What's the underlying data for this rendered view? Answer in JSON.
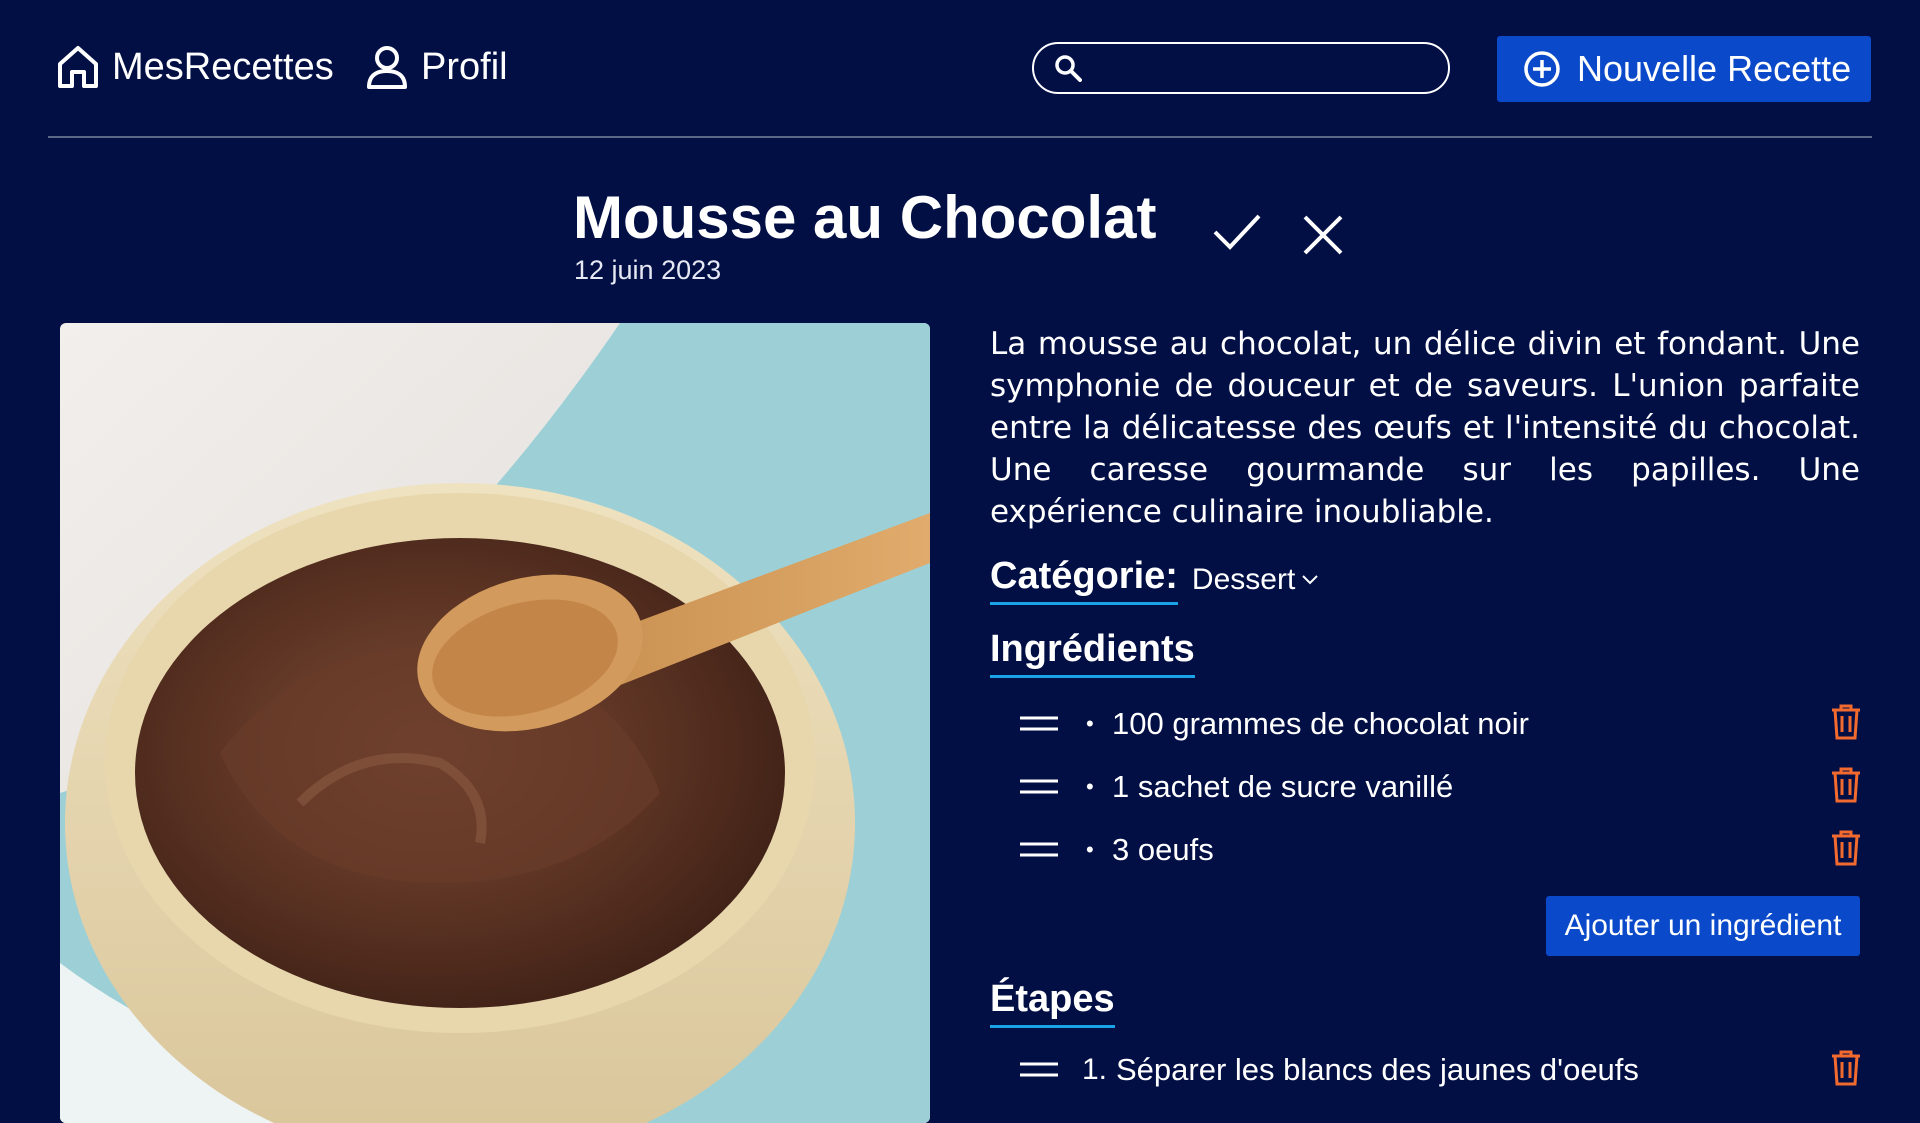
{
  "header": {
    "home_label": "MesRecettes",
    "profile_label": "Profil",
    "search": {
      "value": "",
      "placeholder": ""
    },
    "new_recipe_label": "Nouvelle Recette"
  },
  "recipe": {
    "title": "Mousse au Chocolat",
    "date": "12 juin 2023",
    "description": "La mousse au chocolat, un délice divin et fondant. Une symphonie de douceur et de saveurs. L'union parfaite entre la délicatesse des œufs et l'intensité du chocolat. Une caresse gourmande sur les papilles. Une expérience culinaire inoubliable.",
    "category_label": "Catégorie:",
    "category_value": "Dessert",
    "ingredients_label": "Ingrédients",
    "ingredients": [
      "100 grammes de chocolat noir",
      "1 sachet de sucre vanillé",
      "3 oeufs"
    ],
    "add_ingredient_label": "Ajouter un ingrédient",
    "steps_label": "Étapes",
    "steps": [
      {
        "number": "1.",
        "text": "Séparer les blancs des jaunes d'oeufs"
      }
    ]
  },
  "colors": {
    "background": "#020f45",
    "button": "#0a49c9",
    "underline": "#1aa3e6",
    "trash": "#f26a2e"
  },
  "icons": [
    "home-icon",
    "user-icon",
    "search-icon",
    "plus-circle-icon",
    "check-icon",
    "close-icon",
    "chevron-down-icon",
    "drag-handle-icon",
    "trash-icon"
  ]
}
